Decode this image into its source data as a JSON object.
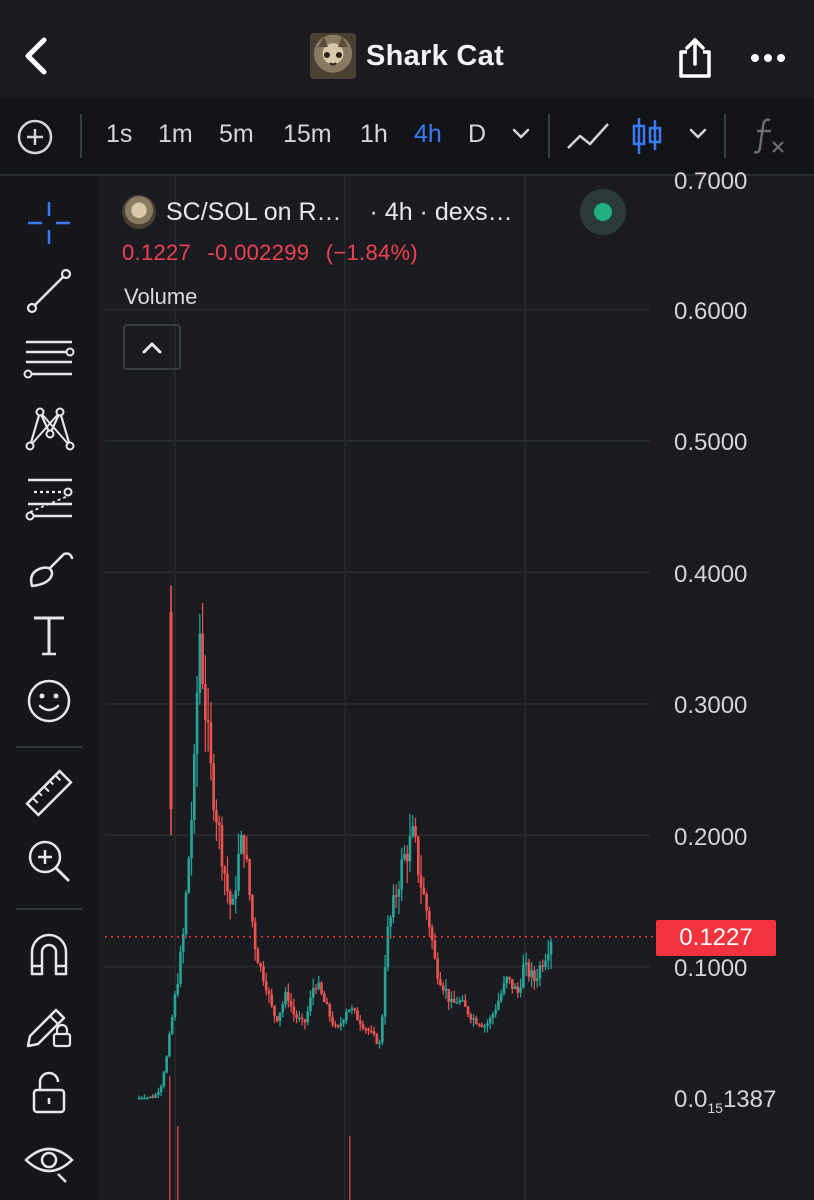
{
  "header": {
    "title": "Shark Cat"
  },
  "toolbar": {
    "timeframes": [
      {
        "label": "1s",
        "active": false
      },
      {
        "label": "1m",
        "active": false
      },
      {
        "label": "5m",
        "active": false
      },
      {
        "label": "15m",
        "active": false
      },
      {
        "label": "1h",
        "active": false
      },
      {
        "label": "4h",
        "active": true
      },
      {
        "label": "D",
        "active": false
      }
    ]
  },
  "legend": {
    "pair": "SC/SOL on R…",
    "meta": "· 4h · dexs…",
    "status_color": "#23b07f",
    "last": "0.1227",
    "change": "-0.002299",
    "change_pct": "(−1.84%)",
    "study": "Volume"
  },
  "price_axis": {
    "top_label": "0.7000",
    "labels": [
      "0.6000",
      "0.5000",
      "0.4000",
      "0.3000",
      "0.2000",
      "0.1000"
    ],
    "low_label_prefix": "0.0",
    "low_label_sub": "15",
    "low_label_suffix": "1387",
    "current_price_tag": "0.1227"
  },
  "colors": {
    "up": "#26a69a",
    "down": "#ef5350",
    "accent": "#3a7bf5",
    "price_tag": "#f2333e"
  },
  "chart_data": {
    "type": "candlestick",
    "ylim": [
      0.0,
      0.7
    ],
    "yticks": [
      0.1,
      0.2,
      0.3,
      0.4,
      0.5,
      0.6
    ],
    "current_price": 0.1227,
    "close_series": [
      0.0001,
      0.0002,
      0.0004,
      0.002,
      0.01,
      0.03,
      0.06,
      0.09,
      0.12,
      0.18,
      0.24,
      0.36,
      0.3,
      0.25,
      0.22,
      0.19,
      0.16,
      0.14,
      0.18,
      0.2,
      0.16,
      0.12,
      0.1,
      0.09,
      0.07,
      0.06,
      0.07,
      0.08,
      0.065,
      0.06,
      0.055,
      0.07,
      0.09,
      0.08,
      0.07,
      0.06,
      0.05,
      0.06,
      0.07,
      0.065,
      0.06,
      0.055,
      0.05,
      0.045,
      0.04,
      0.12,
      0.14,
      0.16,
      0.18,
      0.19,
      0.2,
      0.17,
      0.15,
      0.13,
      0.1,
      0.09,
      0.08,
      0.07,
      0.075,
      0.07,
      0.065,
      0.06,
      0.058,
      0.055,
      0.06,
      0.07,
      0.08,
      0.09,
      0.085,
      0.08,
      0.1,
      0.095,
      0.09,
      0.1,
      0.11,
      0.1227
    ]
  }
}
